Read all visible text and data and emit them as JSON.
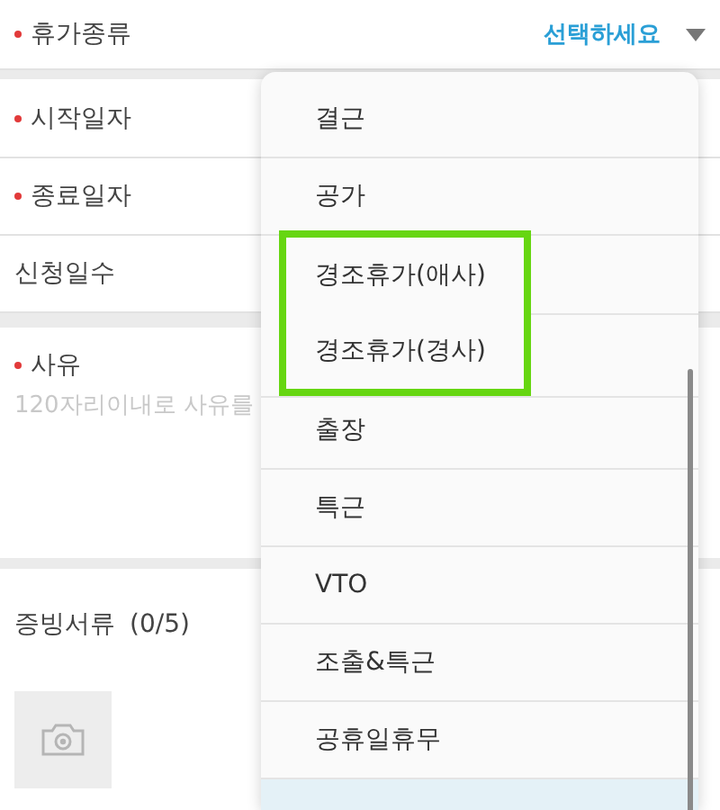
{
  "form": {
    "fields": [
      {
        "kind": "select",
        "label": "휴가종류",
        "required": true,
        "value": "선택하세요"
      },
      {
        "kind": "date",
        "label": "시작일자",
        "required": true
      },
      {
        "kind": "date",
        "label": "종료일자",
        "required": true
      },
      {
        "kind": "readonly",
        "label": "신청일수",
        "required": false
      }
    ]
  },
  "reason": {
    "label": "사유",
    "required": true,
    "placeholder": "120자리이내로 사유를"
  },
  "attachments": {
    "label": "증빙서류",
    "count": "(0/5)"
  },
  "dropdown": {
    "items": [
      {
        "label": "결근",
        "selected": false,
        "highlighted": false
      },
      {
        "label": "공가",
        "selected": false,
        "highlighted": false
      },
      {
        "label": "경조휴가(애사)",
        "selected": false,
        "highlighted": true
      },
      {
        "label": "경조휴가(경사)",
        "selected": false,
        "highlighted": true
      },
      {
        "label": "출장",
        "selected": false,
        "highlighted": false
      },
      {
        "label": "특근",
        "selected": false,
        "highlighted": false
      },
      {
        "label": "VTO",
        "selected": false,
        "highlighted": false
      },
      {
        "label": "조출&특근",
        "selected": false,
        "highlighted": false
      },
      {
        "label": "공휴일휴무",
        "selected": false,
        "highlighted": false
      },
      {
        "selected": true,
        "highlighted": false
      }
    ]
  }
}
